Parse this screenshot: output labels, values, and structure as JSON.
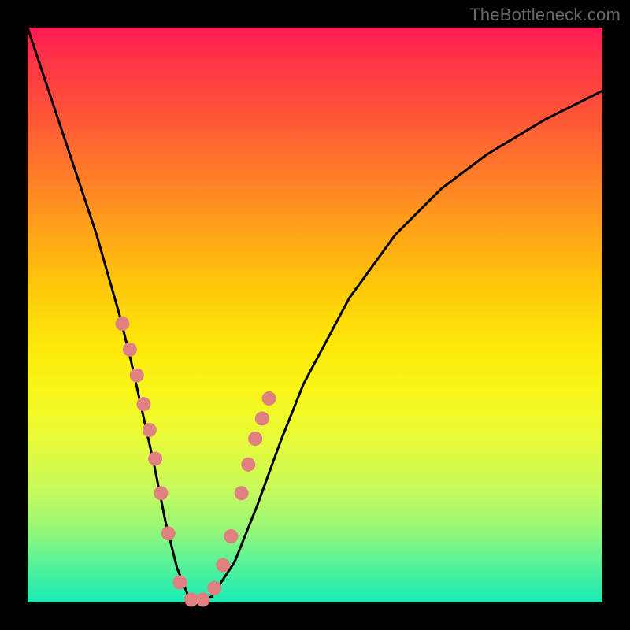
{
  "watermark": "TheBottleneck.com",
  "chart_data": {
    "type": "line",
    "title": "",
    "xlabel": "",
    "ylabel": "",
    "xlim": [
      0,
      100
    ],
    "ylim": [
      0,
      100
    ],
    "series": [
      {
        "name": "bottleneck-curve",
        "x": [
          0,
          4,
          8,
          12,
          16,
          18,
          20,
          22,
          24,
          26,
          28,
          30,
          32,
          36,
          40,
          44,
          48,
          56,
          64,
          72,
          80,
          90,
          100
        ],
        "y": [
          100,
          88,
          76,
          64,
          50,
          42,
          33,
          24,
          14,
          6,
          1,
          0,
          1,
          7,
          17,
          28,
          38,
          53,
          64,
          72,
          78,
          84,
          89
        ]
      }
    ],
    "markers": {
      "name": "data-points",
      "x": [
        16.5,
        17.8,
        19.0,
        20.2,
        21.2,
        22.2,
        23.2,
        24.5,
        26.5,
        28.5,
        30.5,
        32.5,
        34.0,
        35.4,
        37.2,
        38.4,
        39.6,
        40.8,
        42.0
      ],
      "y": [
        48.5,
        44.0,
        39.5,
        34.5,
        30.0,
        25.0,
        19.0,
        12.0,
        3.5,
        0.5,
        0.5,
        2.5,
        6.5,
        11.5,
        19.0,
        24.0,
        28.5,
        32.0,
        35.5
      ],
      "color": "#e08080",
      "radius": 9
    },
    "background_gradient": {
      "top": "#ff1a54",
      "bottom": "#1aeab6"
    }
  }
}
